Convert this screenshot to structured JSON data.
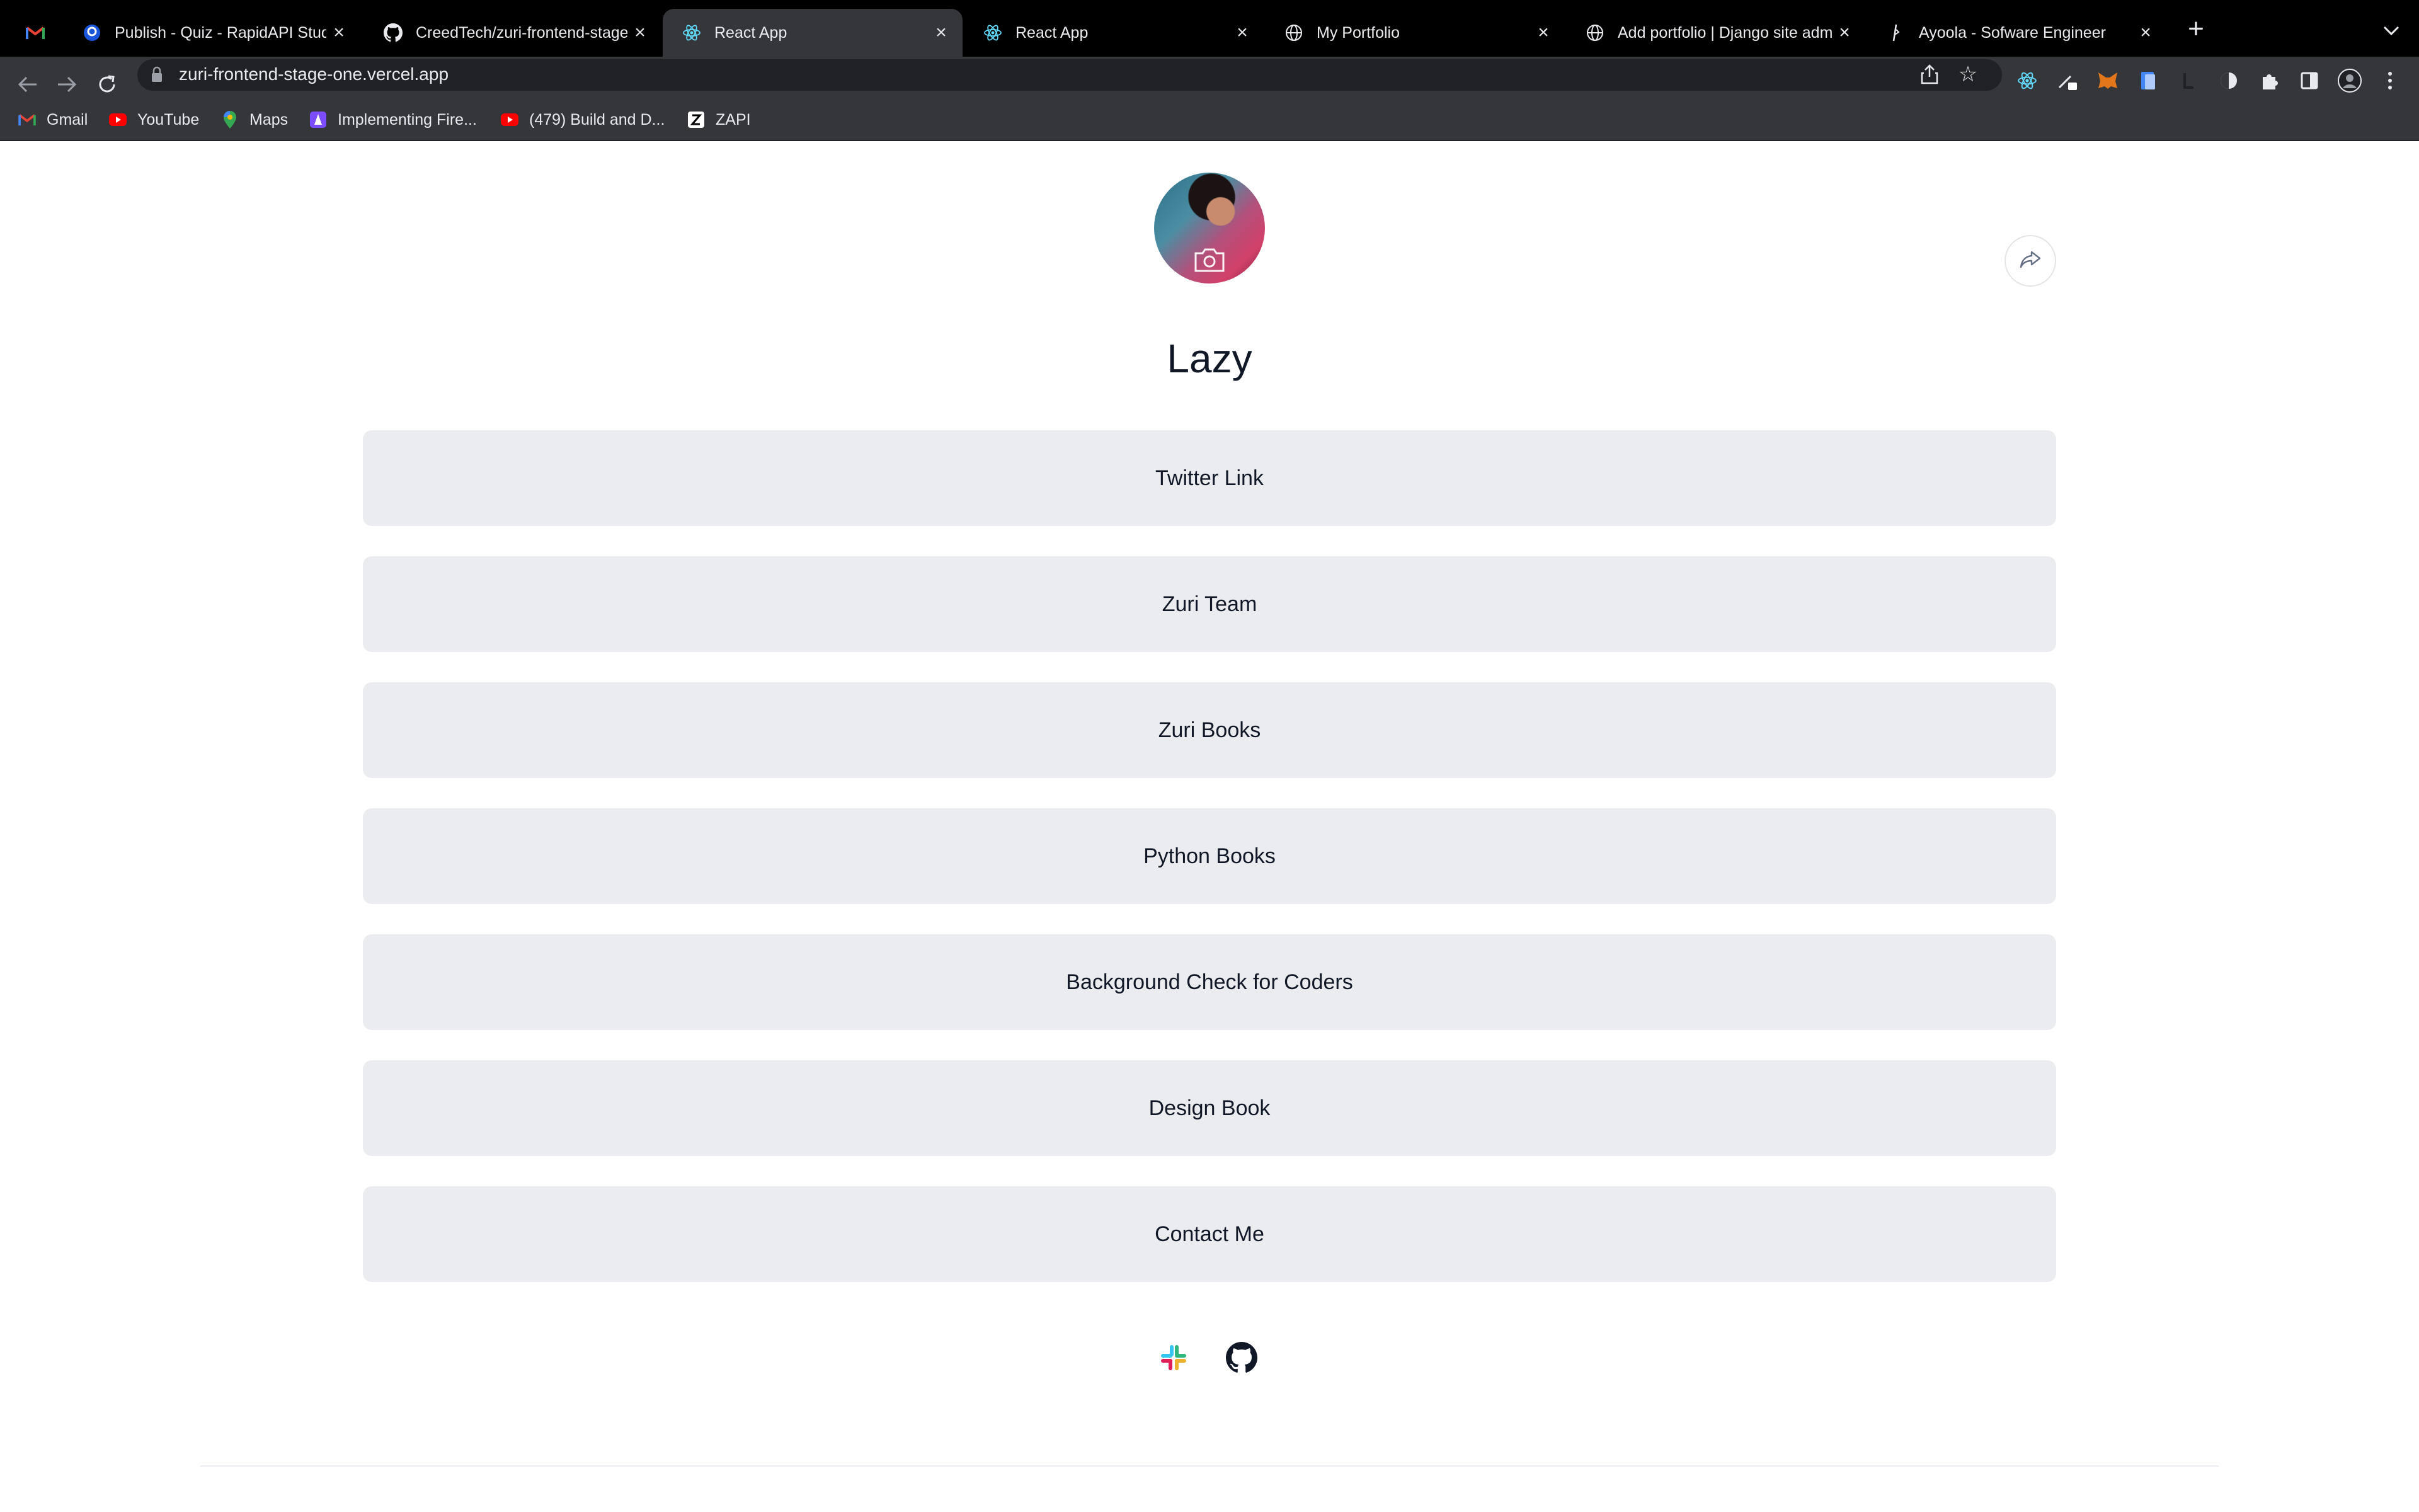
{
  "browser": {
    "tabs": [
      {
        "title": "",
        "icon": "gmail-icon",
        "active": false
      },
      {
        "title": "Publish - Quiz - RapidAPI Studio",
        "icon": "rapidapi-icon",
        "active": false
      },
      {
        "title": "CreedTech/zuri-frontend-stage-one",
        "icon": "github-icon",
        "active": false
      },
      {
        "title": "React App",
        "icon": "react-icon",
        "active": true
      },
      {
        "title": "React App",
        "icon": "react-icon",
        "active": false
      },
      {
        "title": "My Portfolio",
        "icon": "globe-icon",
        "active": false
      },
      {
        "title": "Add portfolio | Django site admin",
        "icon": "globe-icon",
        "active": false
      },
      {
        "title": "Ayoola - Sofware Engineer",
        "icon": "ayoola-icon",
        "active": false
      }
    ],
    "url": "zuri-frontend-stage-one.vercel.app",
    "bookmarks": [
      {
        "label": "Gmail",
        "icon": "gmail-icon"
      },
      {
        "label": "YouTube",
        "icon": "youtube-icon"
      },
      {
        "label": "Maps",
        "icon": "maps-icon"
      },
      {
        "label": "Implementing Fire...",
        "icon": "firebase-icon"
      },
      {
        "label": "(479) Build and D...",
        "icon": "youtube-icon"
      },
      {
        "label": "ZAPI",
        "icon": "zapi-icon"
      }
    ]
  },
  "profile": {
    "name": "Lazy",
    "avatar_icon": "profile-photo",
    "camera_icon": "camera-icon",
    "share_icon": "share-icon"
  },
  "links": [
    {
      "label": "Twitter Link"
    },
    {
      "label": "Zuri Team"
    },
    {
      "label": "Zuri Books"
    },
    {
      "label": "Python Books"
    },
    {
      "label": "Background Check for Coders"
    },
    {
      "label": "Design Book"
    },
    {
      "label": "Contact Me"
    }
  ],
  "social": [
    {
      "icon": "slack-icon"
    },
    {
      "icon": "github-icon"
    }
  ],
  "colors": {
    "button_bg": "#eaecf0",
    "text": "#101828",
    "tab_strip": "#000000",
    "toolbar": "#35363a"
  }
}
